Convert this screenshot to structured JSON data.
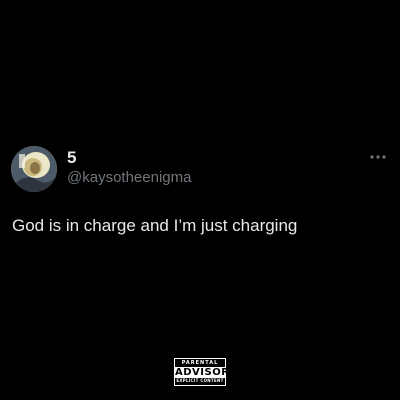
{
  "tweet": {
    "display_name": "5",
    "handle": "@kaysotheenigma",
    "text": "God is in charge and I’m just charging",
    "more_icon": "more-horizontal-icon"
  },
  "parental_advisory": {
    "top": "PARENTAL",
    "middle": "ADVISORY",
    "bottom": "EXPLICIT CONTENT"
  },
  "colors": {
    "background": "#000000",
    "primary_text": "#e7e9ea",
    "secondary_text": "#71767b"
  }
}
